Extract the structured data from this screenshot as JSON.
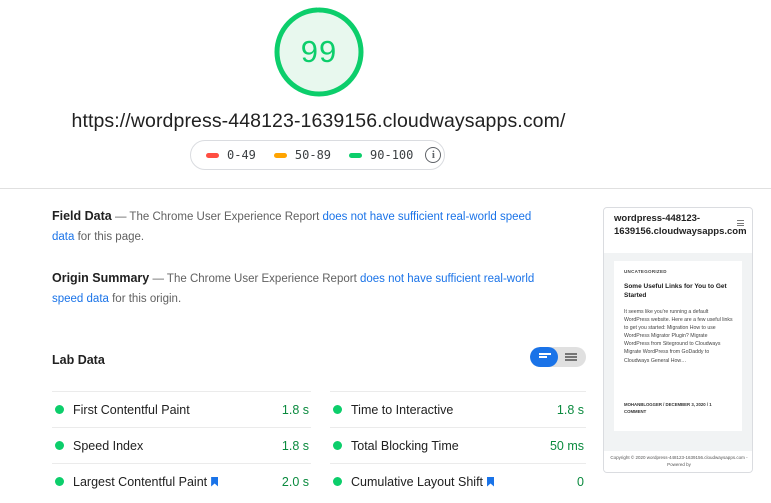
{
  "score": {
    "value": "99",
    "fraction": 0.99,
    "color": "#0cce6b"
  },
  "url": "https://wordpress-448123-1639156.cloudwaysapps.com/",
  "legend": [
    {
      "label": "0-49",
      "color": "#ff4e42"
    },
    {
      "label": "50-89",
      "color": "#ffa400"
    },
    {
      "label": "90-100",
      "color": "#0cce6b"
    }
  ],
  "field_data": {
    "title": "Field Data",
    "prefix": " — The Chrome User Experience Report ",
    "link": "does not have sufficient real-world speed data",
    "suffix": " for this page."
  },
  "origin_summary": {
    "title": "Origin Summary",
    "prefix": " — The Chrome User Experience Report ",
    "link": "does not have sufficient real-world speed data",
    "suffix": " for this origin."
  },
  "lab_data": {
    "title": "Lab Data",
    "metrics": [
      {
        "name": "First Contentful Paint",
        "value": "1.8 s",
        "flag": false
      },
      {
        "name": "Time to Interactive",
        "value": "1.8 s",
        "flag": false
      },
      {
        "name": "Speed Index",
        "value": "1.8 s",
        "flag": false
      },
      {
        "name": "Total Blocking Time",
        "value": "50 ms",
        "flag": false
      },
      {
        "name": "Largest Contentful Paint",
        "value": "2.0 s",
        "flag": true
      },
      {
        "name": "Cumulative Layout Shift",
        "value": "0",
        "flag": true
      }
    ]
  },
  "thumbnail": {
    "site_title": "wordpress-448123-1639156.cloudwaysapps.com",
    "category": "UNCATEGORIZED",
    "post_title": "Some Useful Links for You to Get Started",
    "excerpt": "It seems like you're running a default WordPress website. Here are a few useful links to get you started: Migration How to use WordPress Migrator Plugin? Migrate WordPress from Siteground to Cloudways Migrate WordPress from GoDaddy to Cloudways General How…",
    "meta": "MOHANBLOGGER / DECEMBER 3, 2020 / 1 COMMENT",
    "footer": "Copyright © 2020 wordpress-448123-1639156.cloudwaysapps.com - Powered by"
  }
}
